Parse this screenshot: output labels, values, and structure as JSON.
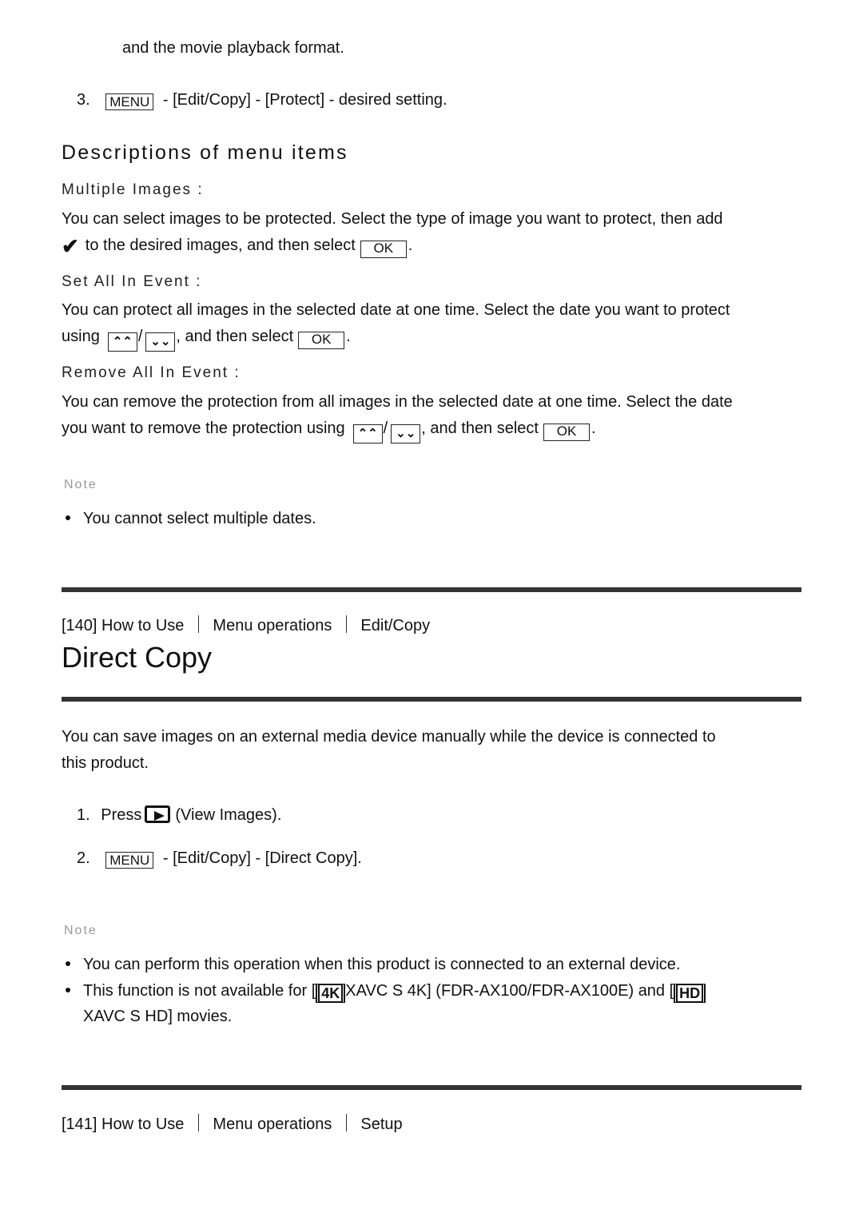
{
  "top_fragment": "and the movie playback format.",
  "step3": {
    "num": "3.",
    "key": "MENU",
    "text": " - [Edit/Copy] - [Protect] - desired setting."
  },
  "descriptions": {
    "heading": "Descriptions of menu items",
    "items": [
      {
        "title": "Multiple Images :",
        "line1": "You can select images to be protected. Select the type of image you want to protect, then add",
        "line2a": "to the desired images, and then select",
        "line2b": "."
      },
      {
        "title": "Set All In Event :",
        "line1": "You can protect all images in the selected date at one time. Select the date you want to protect",
        "line2a": "using",
        "line2b": ", and then select",
        "line2c": "."
      },
      {
        "title": "Remove All In Event :",
        "line1": "You can remove the protection from all images in the selected date at one time. Select the date",
        "line2a": "you want to remove the protection using",
        "line2b": ", and then select",
        "line2c": "."
      }
    ]
  },
  "icons": {
    "ok": "OK",
    "up": "⌃⌃",
    "down": "⌄⌄",
    "slash": "/",
    "check": "✔",
    "menu": "MENU",
    "film4k": "4K",
    "filmhd": "HD"
  },
  "note1": {
    "label": "Note",
    "bullets": [
      "You cannot select multiple dates."
    ]
  },
  "section140": {
    "breadcrumb": [
      "[140] How to Use",
      "Menu operations",
      "Edit/Copy"
    ],
    "title": "Direct Copy",
    "intro1": "You can save images on an external media device manually while the device is connected to",
    "intro2": "this product.",
    "step1": {
      "num": "1.",
      "a": "Press",
      "b": "(View Images)."
    },
    "step2": {
      "num": "2.",
      "text": " - [Edit/Copy] - [Direct Copy]."
    },
    "note_label": "Note",
    "note_b1": "You can perform this operation when this product is connected to an external device.",
    "note_b2a": "This function is not available for [",
    "note_b2b": "XAVC S 4K] (FDR-AX100/FDR-AX100E) and [",
    "note_b2c": "XAVC S HD] movies."
  },
  "section141": {
    "breadcrumb": [
      "[141] How to Use",
      "Menu operations",
      "Setup"
    ]
  }
}
